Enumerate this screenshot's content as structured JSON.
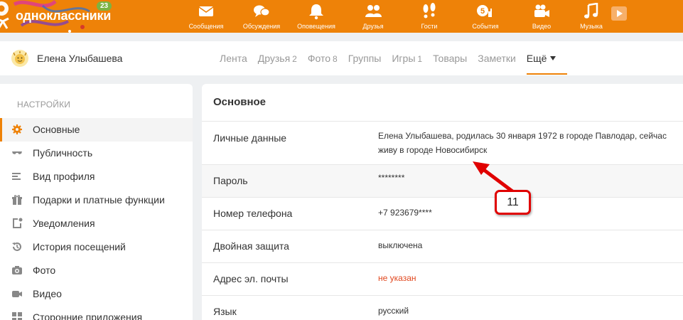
{
  "app": {
    "logo_text": "одноклассники",
    "logo_badge": "23"
  },
  "topnav": [
    {
      "label": "Сообщения",
      "icon": "envelope-icon"
    },
    {
      "label": "Обсуждения",
      "icon": "chat-bubbles-icon"
    },
    {
      "label": "Оповещения",
      "icon": "bell-icon"
    },
    {
      "label": "Друзья",
      "icon": "friends-icon"
    },
    {
      "label": "Гости",
      "icon": "footprints-icon"
    },
    {
      "label": "События",
      "icon": "events-icon",
      "badge": "5"
    },
    {
      "label": "Видео",
      "icon": "video-camera-icon"
    },
    {
      "label": "Музыка",
      "icon": "music-note-icon"
    }
  ],
  "profile": {
    "name": "Елена Улыбашева",
    "tabs": [
      {
        "label": "Лента",
        "count": ""
      },
      {
        "label": "Друзья",
        "count": "2"
      },
      {
        "label": "Фото",
        "count": "8"
      },
      {
        "label": "Группы",
        "count": ""
      },
      {
        "label": "Игры",
        "count": "1"
      },
      {
        "label": "Товары",
        "count": ""
      },
      {
        "label": "Заметки",
        "count": ""
      },
      {
        "label": "Ещё",
        "count": ""
      }
    ]
  },
  "sidebar": {
    "title": "НАСТРОЙКИ",
    "items": [
      {
        "label": "Основные",
        "icon": "gear-icon"
      },
      {
        "label": "Публичность",
        "icon": "glasses-icon"
      },
      {
        "label": "Вид профиля",
        "icon": "layout-lines-icon"
      },
      {
        "label": "Подарки и платные функции",
        "icon": "gift-icon"
      },
      {
        "label": "Уведомления",
        "icon": "notification-icon"
      },
      {
        "label": "История посещений",
        "icon": "history-icon"
      },
      {
        "label": "Фото",
        "icon": "camera-icon"
      },
      {
        "label": "Видео",
        "icon": "video-icon"
      },
      {
        "label": "Сторонние приложения",
        "icon": "apps-icon"
      }
    ]
  },
  "main": {
    "title": "Основное",
    "rows": [
      {
        "label": "Личные данные",
        "value_line1": "Елена Улыбашева, родилась 30 января 1972 в городе Павлодар, сейчас",
        "value_line2": "живу в городе Новосибирск"
      },
      {
        "label": "Пароль",
        "value": "********"
      },
      {
        "label": "Номер телефона",
        "value": "+7 923679****"
      },
      {
        "label": "Двойная защита",
        "value": "выключена"
      },
      {
        "label": "Адрес эл. почты",
        "value": "не указан"
      },
      {
        "label": "Язык",
        "value": "русский"
      }
    ]
  },
  "annotation": {
    "label": "11"
  },
  "colors": {
    "brand": "#ee8208",
    "warn": "#e1481f",
    "annotation": "#e00000"
  }
}
